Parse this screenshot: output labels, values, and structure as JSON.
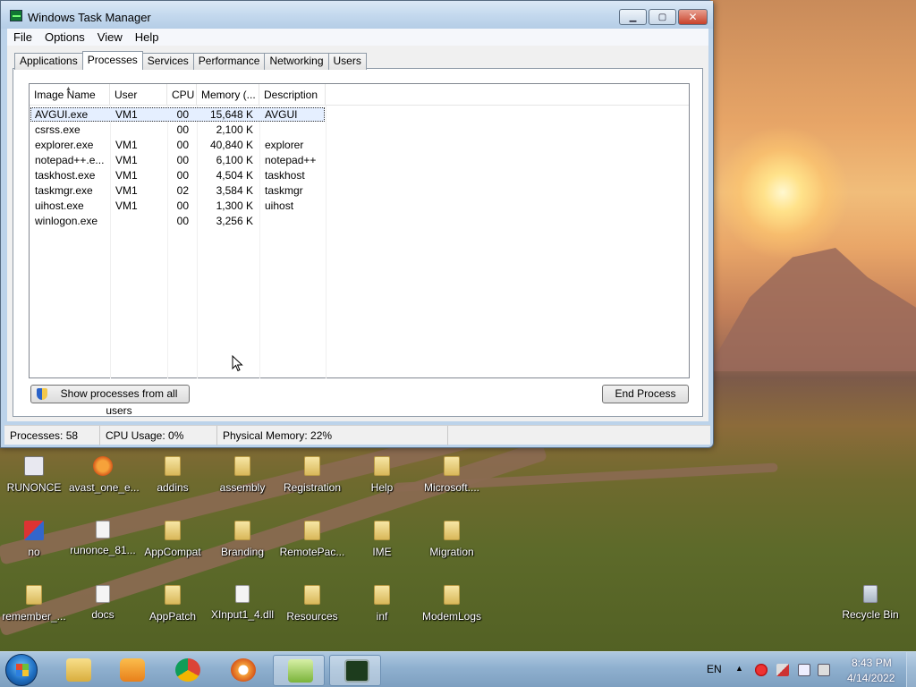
{
  "window": {
    "title": "Windows Task Manager",
    "menu": [
      "File",
      "Options",
      "View",
      "Help"
    ],
    "tabs": [
      "Applications",
      "Processes",
      "Services",
      "Performance",
      "Networking",
      "Users"
    ],
    "active_tab": "Processes",
    "columns": [
      "Image Name",
      "User Name",
      "CPU",
      "Memory (...",
      "Description"
    ],
    "rows": [
      {
        "name": "AVGUI.exe",
        "user": "VM1",
        "cpu": "00",
        "mem": "15,648 K",
        "desc": "AVGUI"
      },
      {
        "name": "csrss.exe",
        "user": "",
        "cpu": "00",
        "mem": "2,100 K",
        "desc": ""
      },
      {
        "name": "explorer.exe",
        "user": "VM1",
        "cpu": "00",
        "mem": "40,840 K",
        "desc": "explorer"
      },
      {
        "name": "notepad++.e...",
        "user": "VM1",
        "cpu": "00",
        "mem": "6,100 K",
        "desc": "notepad++"
      },
      {
        "name": "taskhost.exe",
        "user": "VM1",
        "cpu": "00",
        "mem": "4,504 K",
        "desc": "taskhost"
      },
      {
        "name": "taskmgr.exe",
        "user": "VM1",
        "cpu": "02",
        "mem": "3,584 K",
        "desc": "taskmgr"
      },
      {
        "name": "uihost.exe",
        "user": "VM1",
        "cpu": "00",
        "mem": "1,300 K",
        "desc": "uihost"
      },
      {
        "name": "winlogon.exe",
        "user": "",
        "cpu": "00",
        "mem": "3,256 K",
        "desc": ""
      }
    ],
    "show_all_label": "Show processes from all users",
    "end_process_label": "End Process",
    "status": {
      "processes": "Processes: 58",
      "cpu": "CPU Usage: 0%",
      "memory": "Physical Memory: 22%"
    }
  },
  "desktop_icons": [
    {
      "label": "RUNONCE",
      "icon": "runonce-icon"
    },
    {
      "label": "avast_one_e...",
      "icon": "avast-icon"
    },
    {
      "label": "addins",
      "icon": "folder-icon"
    },
    {
      "label": "assembly",
      "icon": "folder-icon"
    },
    {
      "label": "Registration",
      "icon": "folder-icon"
    },
    {
      "label": "Help",
      "icon": "folder-icon"
    },
    {
      "label": "Microsoft....",
      "icon": "folder-icon"
    },
    {
      "label": "no",
      "icon": "app-icon"
    },
    {
      "label": "runonce_81...",
      "icon": "file-icon"
    },
    {
      "label": "AppCompat",
      "icon": "folder-icon"
    },
    {
      "label": "Branding",
      "icon": "folder-icon"
    },
    {
      "label": "RemotePac...",
      "icon": "folder-icon"
    },
    {
      "label": "IME",
      "icon": "folder-icon"
    },
    {
      "label": "Migration",
      "icon": "folder-icon"
    },
    {
      "label": "remember_...",
      "icon": "folder-icon"
    },
    {
      "label": "docs",
      "icon": "file-icon"
    },
    {
      "label": "AppPatch",
      "icon": "folder-icon"
    },
    {
      "label": "XInput1_4.dll",
      "icon": "file-icon"
    },
    {
      "label": "Resources",
      "icon": "folder-icon"
    },
    {
      "label": "inf",
      "icon": "folder-icon"
    },
    {
      "label": "ModemLogs",
      "icon": "folder-icon"
    },
    {
      "label": "Recycle Bin",
      "icon": "recycle-bin-icon"
    }
  ],
  "taskbar": {
    "language": "EN",
    "time": "8:43 PM",
    "date": "4/14/2022"
  }
}
